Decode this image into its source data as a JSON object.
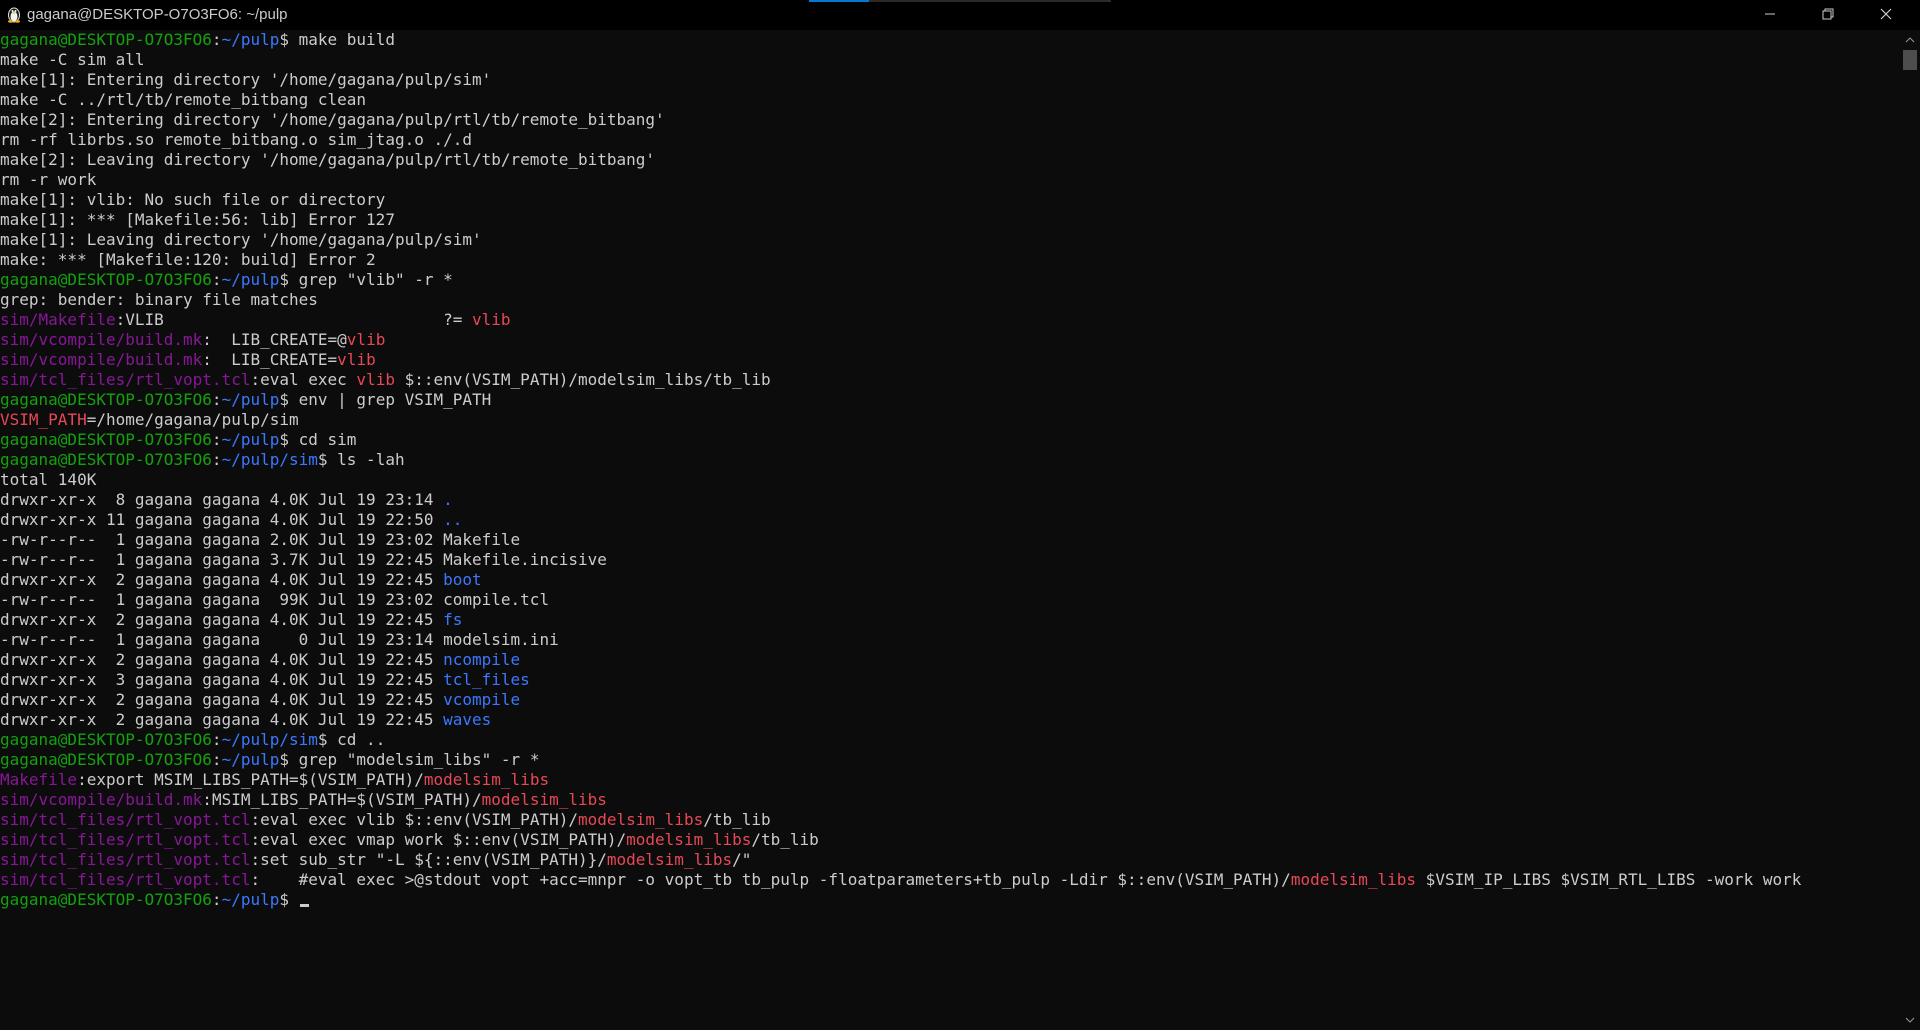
{
  "window": {
    "title": "gagana@DESKTOP-O7O3FO6: ~/pulp",
    "icon": "linux-penguin-icon",
    "controls": {
      "minimize": "minimize-icon",
      "maximize": "restore-icon",
      "close": "close-icon"
    }
  },
  "colors": {
    "background": "#0c0c0c",
    "default_text": "#cccccc",
    "prompt_user": "#13a10e",
    "prompt_path": "#3b78ff",
    "grep_file": "#881798",
    "grep_match": "#e74856",
    "directory": "#3b78ff",
    "accent": "#0078d7"
  },
  "terminal": {
    "lines": [
      [
        {
          "t": "gagana@DESKTOP-O7O3FO6",
          "c": "g"
        },
        {
          "t": ":",
          "c": "w"
        },
        {
          "t": "~/pulp",
          "c": "b"
        },
        {
          "t": "$ make build",
          "c": "w"
        }
      ],
      [
        {
          "t": "make -C sim all",
          "c": "w"
        }
      ],
      [
        {
          "t": "make[1]: Entering directory '/home/gagana/pulp/sim'",
          "c": "w"
        }
      ],
      [
        {
          "t": "make -C ../rtl/tb/remote_bitbang clean",
          "c": "w"
        }
      ],
      [
        {
          "t": "make[2]: Entering directory '/home/gagana/pulp/rtl/tb/remote_bitbang'",
          "c": "w"
        }
      ],
      [
        {
          "t": "rm -rf librbs.so remote_bitbang.o sim_jtag.o ./.d",
          "c": "w"
        }
      ],
      [
        {
          "t": "make[2]: Leaving directory '/home/gagana/pulp/rtl/tb/remote_bitbang'",
          "c": "w"
        }
      ],
      [
        {
          "t": "rm -r work",
          "c": "w"
        }
      ],
      [
        {
          "t": "make[1]: vlib: No such file or directory",
          "c": "w"
        }
      ],
      [
        {
          "t": "make[1]: *** [Makefile:56: lib] Error 127",
          "c": "w"
        }
      ],
      [
        {
          "t": "make[1]: Leaving directory '/home/gagana/pulp/sim'",
          "c": "w"
        }
      ],
      [
        {
          "t": "make: *** [Makefile:120: build] Error 2",
          "c": "w"
        }
      ],
      [
        {
          "t": "gagana@DESKTOP-O7O3FO6",
          "c": "g"
        },
        {
          "t": ":",
          "c": "w"
        },
        {
          "t": "~/pulp",
          "c": "b"
        },
        {
          "t": "$ grep \"vlib\" -r *",
          "c": "w"
        }
      ],
      [
        {
          "t": "grep: bender: binary file matches",
          "c": "w"
        }
      ],
      [
        {
          "t": "sim/Makefile",
          "c": "m"
        },
        {
          "t": ":",
          "c": "w"
        },
        {
          "t": "VLIB                             ?= ",
          "c": "w"
        },
        {
          "t": "vlib",
          "c": "r"
        }
      ],
      [
        {
          "t": "sim/vcompile/build.mk",
          "c": "m"
        },
        {
          "t": ":",
          "c": "w"
        },
        {
          "t": "  LIB_CREATE=@",
          "c": "w"
        },
        {
          "t": "vlib",
          "c": "r"
        }
      ],
      [
        {
          "t": "sim/vcompile/build.mk",
          "c": "m"
        },
        {
          "t": ":",
          "c": "w"
        },
        {
          "t": "  LIB_CREATE=",
          "c": "w"
        },
        {
          "t": "vlib",
          "c": "r"
        }
      ],
      [
        {
          "t": "sim/tcl_files/rtl_vopt.tcl",
          "c": "m"
        },
        {
          "t": ":",
          "c": "w"
        },
        {
          "t": "eval exec ",
          "c": "w"
        },
        {
          "t": "vlib",
          "c": "r"
        },
        {
          "t": " $::env(VSIM_PATH)/modelsim_libs/tb_lib",
          "c": "w"
        }
      ],
      [
        {
          "t": "gagana@DESKTOP-O7O3FO6",
          "c": "g"
        },
        {
          "t": ":",
          "c": "w"
        },
        {
          "t": "~/pulp",
          "c": "b"
        },
        {
          "t": "$ env | grep VSIM_PATH",
          "c": "w"
        }
      ],
      [
        {
          "t": "VSIM_PATH",
          "c": "r"
        },
        {
          "t": "=/home/gagana/pulp/sim",
          "c": "w"
        }
      ],
      [
        {
          "t": "gagana@DESKTOP-O7O3FO6",
          "c": "g"
        },
        {
          "t": ":",
          "c": "w"
        },
        {
          "t": "~/pulp",
          "c": "b"
        },
        {
          "t": "$ cd sim",
          "c": "w"
        }
      ],
      [
        {
          "t": "gagana@DESKTOP-O7O3FO6",
          "c": "g"
        },
        {
          "t": ":",
          "c": "w"
        },
        {
          "t": "~/pulp/sim",
          "c": "b"
        },
        {
          "t": "$ ls -lah",
          "c": "w"
        }
      ],
      [
        {
          "t": "total 140K",
          "c": "w"
        }
      ],
      [
        {
          "t": "drwxr-xr-x  8 gagana gagana 4.0K Jul 19 23:14 ",
          "c": "w"
        },
        {
          "t": ".",
          "c": "b"
        }
      ],
      [
        {
          "t": "drwxr-xr-x 11 gagana gagana 4.0K Jul 19 22:50 ",
          "c": "w"
        },
        {
          "t": "..",
          "c": "b"
        }
      ],
      [
        {
          "t": "-rw-r--r--  1 gagana gagana 2.0K Jul 19 23:02 Makefile",
          "c": "w"
        }
      ],
      [
        {
          "t": "-rw-r--r--  1 gagana gagana 3.7K Jul 19 22:45 Makefile.incisive",
          "c": "w"
        }
      ],
      [
        {
          "t": "drwxr-xr-x  2 gagana gagana 4.0K Jul 19 22:45 ",
          "c": "w"
        },
        {
          "t": "boot",
          "c": "b"
        }
      ],
      [
        {
          "t": "-rw-r--r--  1 gagana gagana  99K Jul 19 23:02 compile.tcl",
          "c": "w"
        }
      ],
      [
        {
          "t": "drwxr-xr-x  2 gagana gagana 4.0K Jul 19 22:45 ",
          "c": "w"
        },
        {
          "t": "fs",
          "c": "b"
        }
      ],
      [
        {
          "t": "-rw-r--r--  1 gagana gagana    0 Jul 19 23:14 modelsim.ini",
          "c": "w"
        }
      ],
      [
        {
          "t": "drwxr-xr-x  2 gagana gagana 4.0K Jul 19 22:45 ",
          "c": "w"
        },
        {
          "t": "ncompile",
          "c": "b"
        }
      ],
      [
        {
          "t": "drwxr-xr-x  3 gagana gagana 4.0K Jul 19 22:45 ",
          "c": "w"
        },
        {
          "t": "tcl_files",
          "c": "b"
        }
      ],
      [
        {
          "t": "drwxr-xr-x  2 gagana gagana 4.0K Jul 19 22:45 ",
          "c": "w"
        },
        {
          "t": "vcompile",
          "c": "b"
        }
      ],
      [
        {
          "t": "drwxr-xr-x  2 gagana gagana 4.0K Jul 19 22:45 ",
          "c": "w"
        },
        {
          "t": "waves",
          "c": "b"
        }
      ],
      [
        {
          "t": "gagana@DESKTOP-O7O3FO6",
          "c": "g"
        },
        {
          "t": ":",
          "c": "w"
        },
        {
          "t": "~/pulp/sim",
          "c": "b"
        },
        {
          "t": "$ cd ..",
          "c": "w"
        }
      ],
      [
        {
          "t": "gagana@DESKTOP-O7O3FO6",
          "c": "g"
        },
        {
          "t": ":",
          "c": "w"
        },
        {
          "t": "~/pulp",
          "c": "b"
        },
        {
          "t": "$ grep \"modelsim_libs\" -r *",
          "c": "w"
        }
      ],
      [
        {
          "t": "Makefile",
          "c": "m"
        },
        {
          "t": ":",
          "c": "w"
        },
        {
          "t": "export MSIM_LIBS_PATH=$(VSIM_PATH)/",
          "c": "w"
        },
        {
          "t": "modelsim_libs",
          "c": "r"
        }
      ],
      [
        {
          "t": "sim/vcompile/build.mk",
          "c": "m"
        },
        {
          "t": ":",
          "c": "w"
        },
        {
          "t": "MSIM_LIBS_PATH=$(VSIM_PATH)/",
          "c": "w"
        },
        {
          "t": "modelsim_libs",
          "c": "r"
        }
      ],
      [
        {
          "t": "sim/tcl_files/rtl_vopt.tcl",
          "c": "m"
        },
        {
          "t": ":",
          "c": "w"
        },
        {
          "t": "eval exec vlib $::env(VSIM_PATH)/",
          "c": "w"
        },
        {
          "t": "modelsim_libs",
          "c": "r"
        },
        {
          "t": "/tb_lib",
          "c": "w"
        }
      ],
      [
        {
          "t": "sim/tcl_files/rtl_vopt.tcl",
          "c": "m"
        },
        {
          "t": ":",
          "c": "w"
        },
        {
          "t": "eval exec vmap work $::env(VSIM_PATH)/",
          "c": "w"
        },
        {
          "t": "modelsim_libs",
          "c": "r"
        },
        {
          "t": "/tb_lib",
          "c": "w"
        }
      ],
      [
        {
          "t": "sim/tcl_files/rtl_vopt.tcl",
          "c": "m"
        },
        {
          "t": ":",
          "c": "w"
        },
        {
          "t": "set sub_str \"-L ${::env(VSIM_PATH)}/",
          "c": "w"
        },
        {
          "t": "modelsim_libs",
          "c": "r"
        },
        {
          "t": "/\"",
          "c": "w"
        }
      ],
      [
        {
          "t": "sim/tcl_files/rtl_vopt.tcl",
          "c": "m"
        },
        {
          "t": ":",
          "c": "w"
        },
        {
          "t": "    #eval exec >@stdout vopt +acc=mnpr -o vopt_tb tb_pulp -floatparameters+tb_pulp -Ldir $::env(VSIM_PATH)/",
          "c": "w"
        },
        {
          "t": "modelsim_libs",
          "c": "r"
        },
        {
          "t": " $VSIM_IP_LIBS $VSIM_RTL_LIBS -work work",
          "c": "w"
        }
      ],
      [
        {
          "t": "gagana@DESKTOP-O7O3FO6",
          "c": "g"
        },
        {
          "t": ":",
          "c": "w"
        },
        {
          "t": "~/pulp",
          "c": "b"
        },
        {
          "t": "$ ",
          "c": "w"
        }
      ]
    ]
  }
}
